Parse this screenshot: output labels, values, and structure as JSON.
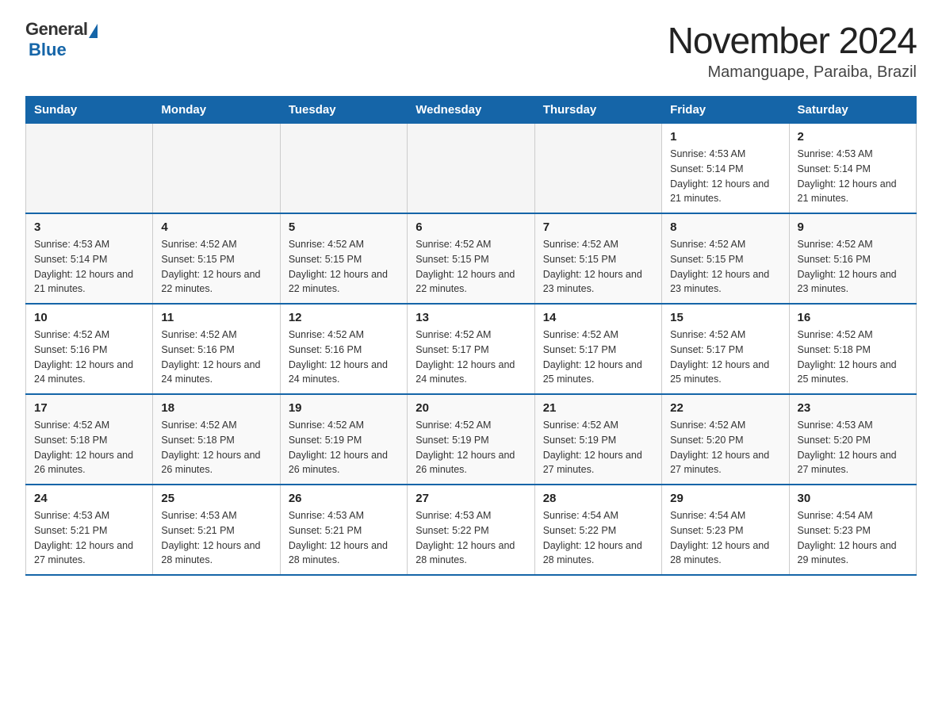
{
  "logo": {
    "general": "General",
    "blue": "Blue"
  },
  "title": "November 2024",
  "subtitle": "Mamanguape, Paraiba, Brazil",
  "days_of_week": [
    "Sunday",
    "Monday",
    "Tuesday",
    "Wednesday",
    "Thursday",
    "Friday",
    "Saturday"
  ],
  "weeks": [
    [
      {
        "day": "",
        "info": ""
      },
      {
        "day": "",
        "info": ""
      },
      {
        "day": "",
        "info": ""
      },
      {
        "day": "",
        "info": ""
      },
      {
        "day": "",
        "info": ""
      },
      {
        "day": "1",
        "info": "Sunrise: 4:53 AM\nSunset: 5:14 PM\nDaylight: 12 hours and 21 minutes."
      },
      {
        "day": "2",
        "info": "Sunrise: 4:53 AM\nSunset: 5:14 PM\nDaylight: 12 hours and 21 minutes."
      }
    ],
    [
      {
        "day": "3",
        "info": "Sunrise: 4:53 AM\nSunset: 5:14 PM\nDaylight: 12 hours and 21 minutes."
      },
      {
        "day": "4",
        "info": "Sunrise: 4:52 AM\nSunset: 5:15 PM\nDaylight: 12 hours and 22 minutes."
      },
      {
        "day": "5",
        "info": "Sunrise: 4:52 AM\nSunset: 5:15 PM\nDaylight: 12 hours and 22 minutes."
      },
      {
        "day": "6",
        "info": "Sunrise: 4:52 AM\nSunset: 5:15 PM\nDaylight: 12 hours and 22 minutes."
      },
      {
        "day": "7",
        "info": "Sunrise: 4:52 AM\nSunset: 5:15 PM\nDaylight: 12 hours and 23 minutes."
      },
      {
        "day": "8",
        "info": "Sunrise: 4:52 AM\nSunset: 5:15 PM\nDaylight: 12 hours and 23 minutes."
      },
      {
        "day": "9",
        "info": "Sunrise: 4:52 AM\nSunset: 5:16 PM\nDaylight: 12 hours and 23 minutes."
      }
    ],
    [
      {
        "day": "10",
        "info": "Sunrise: 4:52 AM\nSunset: 5:16 PM\nDaylight: 12 hours and 24 minutes."
      },
      {
        "day": "11",
        "info": "Sunrise: 4:52 AM\nSunset: 5:16 PM\nDaylight: 12 hours and 24 minutes."
      },
      {
        "day": "12",
        "info": "Sunrise: 4:52 AM\nSunset: 5:16 PM\nDaylight: 12 hours and 24 minutes."
      },
      {
        "day": "13",
        "info": "Sunrise: 4:52 AM\nSunset: 5:17 PM\nDaylight: 12 hours and 24 minutes."
      },
      {
        "day": "14",
        "info": "Sunrise: 4:52 AM\nSunset: 5:17 PM\nDaylight: 12 hours and 25 minutes."
      },
      {
        "day": "15",
        "info": "Sunrise: 4:52 AM\nSunset: 5:17 PM\nDaylight: 12 hours and 25 minutes."
      },
      {
        "day": "16",
        "info": "Sunrise: 4:52 AM\nSunset: 5:18 PM\nDaylight: 12 hours and 25 minutes."
      }
    ],
    [
      {
        "day": "17",
        "info": "Sunrise: 4:52 AM\nSunset: 5:18 PM\nDaylight: 12 hours and 26 minutes."
      },
      {
        "day": "18",
        "info": "Sunrise: 4:52 AM\nSunset: 5:18 PM\nDaylight: 12 hours and 26 minutes."
      },
      {
        "day": "19",
        "info": "Sunrise: 4:52 AM\nSunset: 5:19 PM\nDaylight: 12 hours and 26 minutes."
      },
      {
        "day": "20",
        "info": "Sunrise: 4:52 AM\nSunset: 5:19 PM\nDaylight: 12 hours and 26 minutes."
      },
      {
        "day": "21",
        "info": "Sunrise: 4:52 AM\nSunset: 5:19 PM\nDaylight: 12 hours and 27 minutes."
      },
      {
        "day": "22",
        "info": "Sunrise: 4:52 AM\nSunset: 5:20 PM\nDaylight: 12 hours and 27 minutes."
      },
      {
        "day": "23",
        "info": "Sunrise: 4:53 AM\nSunset: 5:20 PM\nDaylight: 12 hours and 27 minutes."
      }
    ],
    [
      {
        "day": "24",
        "info": "Sunrise: 4:53 AM\nSunset: 5:21 PM\nDaylight: 12 hours and 27 minutes."
      },
      {
        "day": "25",
        "info": "Sunrise: 4:53 AM\nSunset: 5:21 PM\nDaylight: 12 hours and 28 minutes."
      },
      {
        "day": "26",
        "info": "Sunrise: 4:53 AM\nSunset: 5:21 PM\nDaylight: 12 hours and 28 minutes."
      },
      {
        "day": "27",
        "info": "Sunrise: 4:53 AM\nSunset: 5:22 PM\nDaylight: 12 hours and 28 minutes."
      },
      {
        "day": "28",
        "info": "Sunrise: 4:54 AM\nSunset: 5:22 PM\nDaylight: 12 hours and 28 minutes."
      },
      {
        "day": "29",
        "info": "Sunrise: 4:54 AM\nSunset: 5:23 PM\nDaylight: 12 hours and 28 minutes."
      },
      {
        "day": "30",
        "info": "Sunrise: 4:54 AM\nSunset: 5:23 PM\nDaylight: 12 hours and 29 minutes."
      }
    ]
  ]
}
